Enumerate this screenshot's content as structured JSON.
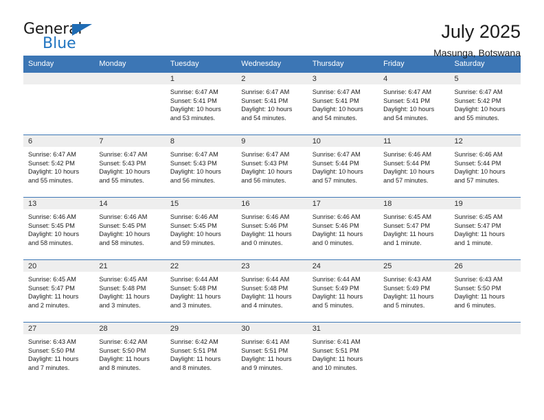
{
  "brand": {
    "name_line1": "General",
    "name_line2": "Blue",
    "accent_color": "#1f6cb4"
  },
  "header": {
    "title": "July 2025",
    "subtitle": "Masunga, Botswana",
    "header_bg_color": "#3c76b5",
    "daynum_bg_color": "#eeeeee"
  },
  "weekdays": [
    "Sunday",
    "Monday",
    "Tuesday",
    "Wednesday",
    "Thursday",
    "Friday",
    "Saturday"
  ],
  "weeks": [
    [
      {
        "day": "",
        "sunrise": "",
        "sunset": "",
        "daylight": "",
        "empty": true
      },
      {
        "day": "",
        "sunrise": "",
        "sunset": "",
        "daylight": "",
        "empty": true
      },
      {
        "day": "1",
        "sunrise": "Sunrise: 6:47 AM",
        "sunset": "Sunset: 5:41 PM",
        "daylight": "Daylight: 10 hours and 53 minutes."
      },
      {
        "day": "2",
        "sunrise": "Sunrise: 6:47 AM",
        "sunset": "Sunset: 5:41 PM",
        "daylight": "Daylight: 10 hours and 54 minutes."
      },
      {
        "day": "3",
        "sunrise": "Sunrise: 6:47 AM",
        "sunset": "Sunset: 5:41 PM",
        "daylight": "Daylight: 10 hours and 54 minutes."
      },
      {
        "day": "4",
        "sunrise": "Sunrise: 6:47 AM",
        "sunset": "Sunset: 5:41 PM",
        "daylight": "Daylight: 10 hours and 54 minutes."
      },
      {
        "day": "5",
        "sunrise": "Sunrise: 6:47 AM",
        "sunset": "Sunset: 5:42 PM",
        "daylight": "Daylight: 10 hours and 55 minutes."
      }
    ],
    [
      {
        "day": "6",
        "sunrise": "Sunrise: 6:47 AM",
        "sunset": "Sunset: 5:42 PM",
        "daylight": "Daylight: 10 hours and 55 minutes."
      },
      {
        "day": "7",
        "sunrise": "Sunrise: 6:47 AM",
        "sunset": "Sunset: 5:43 PM",
        "daylight": "Daylight: 10 hours and 55 minutes."
      },
      {
        "day": "8",
        "sunrise": "Sunrise: 6:47 AM",
        "sunset": "Sunset: 5:43 PM",
        "daylight": "Daylight: 10 hours and 56 minutes."
      },
      {
        "day": "9",
        "sunrise": "Sunrise: 6:47 AM",
        "sunset": "Sunset: 5:43 PM",
        "daylight": "Daylight: 10 hours and 56 minutes."
      },
      {
        "day": "10",
        "sunrise": "Sunrise: 6:47 AM",
        "sunset": "Sunset: 5:44 PM",
        "daylight": "Daylight: 10 hours and 57 minutes."
      },
      {
        "day": "11",
        "sunrise": "Sunrise: 6:46 AM",
        "sunset": "Sunset: 5:44 PM",
        "daylight": "Daylight: 10 hours and 57 minutes."
      },
      {
        "day": "12",
        "sunrise": "Sunrise: 6:46 AM",
        "sunset": "Sunset: 5:44 PM",
        "daylight": "Daylight: 10 hours and 57 minutes."
      }
    ],
    [
      {
        "day": "13",
        "sunrise": "Sunrise: 6:46 AM",
        "sunset": "Sunset: 5:45 PM",
        "daylight": "Daylight: 10 hours and 58 minutes."
      },
      {
        "day": "14",
        "sunrise": "Sunrise: 6:46 AM",
        "sunset": "Sunset: 5:45 PM",
        "daylight": "Daylight: 10 hours and 58 minutes."
      },
      {
        "day": "15",
        "sunrise": "Sunrise: 6:46 AM",
        "sunset": "Sunset: 5:45 PM",
        "daylight": "Daylight: 10 hours and 59 minutes."
      },
      {
        "day": "16",
        "sunrise": "Sunrise: 6:46 AM",
        "sunset": "Sunset: 5:46 PM",
        "daylight": "Daylight: 11 hours and 0 minutes."
      },
      {
        "day": "17",
        "sunrise": "Sunrise: 6:46 AM",
        "sunset": "Sunset: 5:46 PM",
        "daylight": "Daylight: 11 hours and 0 minutes."
      },
      {
        "day": "18",
        "sunrise": "Sunrise: 6:45 AM",
        "sunset": "Sunset: 5:47 PM",
        "daylight": "Daylight: 11 hours and 1 minute."
      },
      {
        "day": "19",
        "sunrise": "Sunrise: 6:45 AM",
        "sunset": "Sunset: 5:47 PM",
        "daylight": "Daylight: 11 hours and 1 minute."
      }
    ],
    [
      {
        "day": "20",
        "sunrise": "Sunrise: 6:45 AM",
        "sunset": "Sunset: 5:47 PM",
        "daylight": "Daylight: 11 hours and 2 minutes."
      },
      {
        "day": "21",
        "sunrise": "Sunrise: 6:45 AM",
        "sunset": "Sunset: 5:48 PM",
        "daylight": "Daylight: 11 hours and 3 minutes."
      },
      {
        "day": "22",
        "sunrise": "Sunrise: 6:44 AM",
        "sunset": "Sunset: 5:48 PM",
        "daylight": "Daylight: 11 hours and 3 minutes."
      },
      {
        "day": "23",
        "sunrise": "Sunrise: 6:44 AM",
        "sunset": "Sunset: 5:48 PM",
        "daylight": "Daylight: 11 hours and 4 minutes."
      },
      {
        "day": "24",
        "sunrise": "Sunrise: 6:44 AM",
        "sunset": "Sunset: 5:49 PM",
        "daylight": "Daylight: 11 hours and 5 minutes."
      },
      {
        "day": "25",
        "sunrise": "Sunrise: 6:43 AM",
        "sunset": "Sunset: 5:49 PM",
        "daylight": "Daylight: 11 hours and 5 minutes."
      },
      {
        "day": "26",
        "sunrise": "Sunrise: 6:43 AM",
        "sunset": "Sunset: 5:50 PM",
        "daylight": "Daylight: 11 hours and 6 minutes."
      }
    ],
    [
      {
        "day": "27",
        "sunrise": "Sunrise: 6:43 AM",
        "sunset": "Sunset: 5:50 PM",
        "daylight": "Daylight: 11 hours and 7 minutes."
      },
      {
        "day": "28",
        "sunrise": "Sunrise: 6:42 AM",
        "sunset": "Sunset: 5:50 PM",
        "daylight": "Daylight: 11 hours and 8 minutes."
      },
      {
        "day": "29",
        "sunrise": "Sunrise: 6:42 AM",
        "sunset": "Sunset: 5:51 PM",
        "daylight": "Daylight: 11 hours and 8 minutes."
      },
      {
        "day": "30",
        "sunrise": "Sunrise: 6:41 AM",
        "sunset": "Sunset: 5:51 PM",
        "daylight": "Daylight: 11 hours and 9 minutes."
      },
      {
        "day": "31",
        "sunrise": "Sunrise: 6:41 AM",
        "sunset": "Sunset: 5:51 PM",
        "daylight": "Daylight: 11 hours and 10 minutes."
      },
      {
        "day": "",
        "sunrise": "",
        "sunset": "",
        "daylight": "",
        "empty": true
      },
      {
        "day": "",
        "sunrise": "",
        "sunset": "",
        "daylight": "",
        "empty": true
      }
    ]
  ]
}
